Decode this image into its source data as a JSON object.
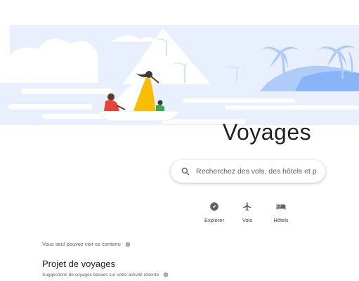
{
  "page": {
    "title": "Voyages"
  },
  "search": {
    "placeholder": "Recherchez des vols, des hôtels et plu..."
  },
  "categories": [
    {
      "label": "Explorer",
      "icon": "compass-icon"
    },
    {
      "label": "Vols",
      "icon": "airplane-icon"
    },
    {
      "label": "Hôtels",
      "icon": "hotel-bed-icon"
    }
  ],
  "privacy_note": {
    "text": "Vous seul pouvez voir ce contenu",
    "icon": "info-icon"
  },
  "section": {
    "title": "Projet de voyages",
    "subtitle": "Suggestions de voyages basées sur votre activité récente",
    "icon": "info-icon"
  },
  "colors": {
    "sky": "#e8f0fe",
    "water": "#d2e3fc",
    "palm": "#aecbfa",
    "text_primary": "#202124",
    "text_secondary": "#5f6368",
    "icon": "#5f6368"
  }
}
